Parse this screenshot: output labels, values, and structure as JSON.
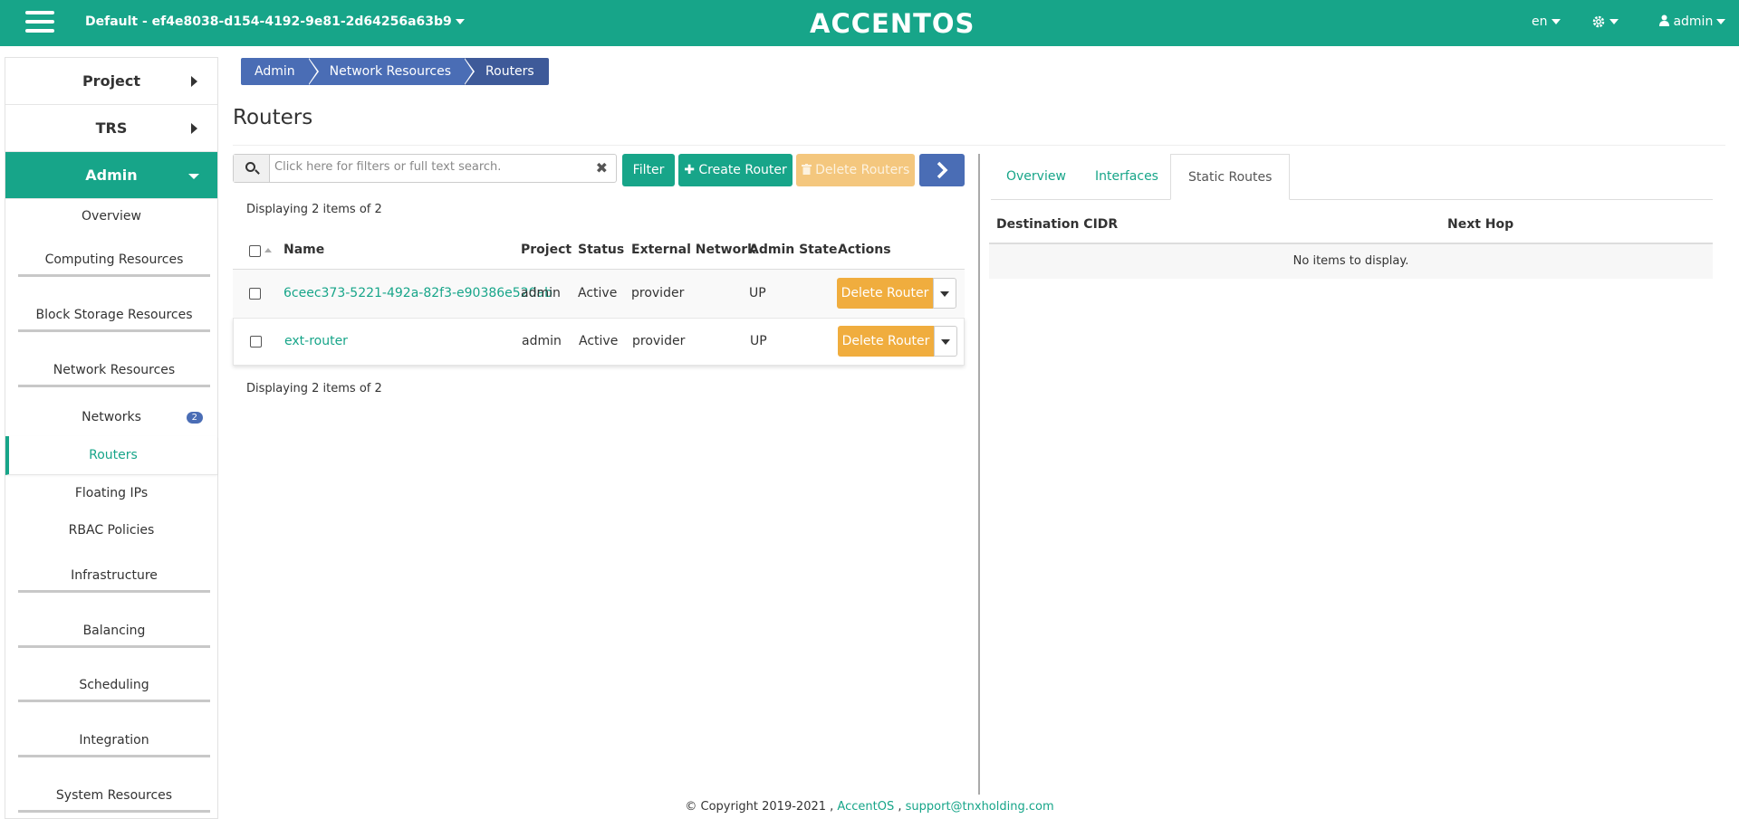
{
  "header": {
    "project_selector": "Default - ef4e8038-d154-4192-9e81-2d64256a63b9",
    "logo": "ACCENTOS",
    "language": "en",
    "user": "admin"
  },
  "sidebar": {
    "sections": [
      {
        "label": "Project"
      },
      {
        "label": "TRS"
      },
      {
        "label": "Admin"
      }
    ],
    "items": [
      {
        "label": "Overview"
      },
      {
        "label": "Computing Resources"
      },
      {
        "label": "Block Storage Resources"
      },
      {
        "label": "Network Resources"
      },
      {
        "label": "Networks",
        "badge": "2"
      },
      {
        "label": "Routers"
      },
      {
        "label": "Floating IPs"
      },
      {
        "label": "RBAC Policies"
      },
      {
        "label": "Infrastructure"
      },
      {
        "label": "Balancing"
      },
      {
        "label": "Scheduling"
      },
      {
        "label": "Integration"
      },
      {
        "label": "System Resources"
      }
    ]
  },
  "breadcrumb": [
    "Admin",
    "Network Resources",
    "Routers"
  ],
  "page": {
    "title": "Routers"
  },
  "toolbar": {
    "search_placeholder": "Click here for filters or full text search.",
    "filter_label": "Filter",
    "create_label": "Create Router",
    "delete_label": "Delete Routers"
  },
  "table": {
    "count_text": "Displaying 2 items of 2",
    "columns": [
      "Name",
      "Project",
      "Status",
      "External Network",
      "Admin State",
      "Actions"
    ],
    "rows": [
      {
        "name": "6ceec373-5221-492a-82f3-e90386e520ab",
        "project": "admin",
        "status": "Active",
        "external_network": "provider",
        "admin_state": "UP",
        "action": "Delete Router"
      },
      {
        "name": "ext-router",
        "project": "admin",
        "status": "Active",
        "external_network": "provider",
        "admin_state": "UP",
        "action": "Delete Router"
      }
    ]
  },
  "detail": {
    "tabs": [
      "Overview",
      "Interfaces",
      "Static Routes"
    ],
    "columns": [
      "Destination CIDR",
      "Next Hop"
    ],
    "empty_text": "No items to display."
  },
  "footer": {
    "copyright": "© Copyright 2019-2021 ,",
    "brand": "AccentOS",
    "separator": ",",
    "email": "support@tnxholding.com"
  },
  "colors": {
    "accent": "#17a589",
    "breadcrumb": "#4a6db5",
    "warning": "#f0ad3e"
  }
}
